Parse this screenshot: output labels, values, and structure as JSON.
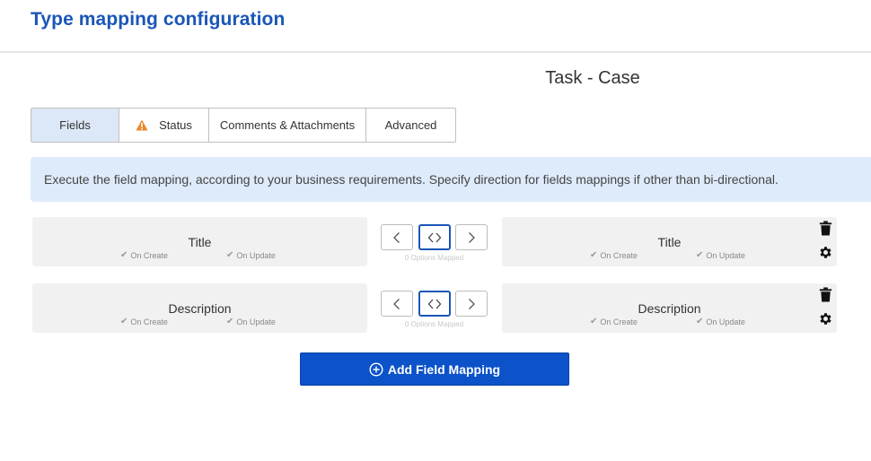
{
  "header": {
    "title": "Type mapping configuration"
  },
  "mapping": {
    "name": "Task - Case"
  },
  "tabs": [
    {
      "label": "Fields",
      "active": true
    },
    {
      "label": "Status",
      "icon": "warning-icon"
    },
    {
      "label": "Comments & Attachments"
    },
    {
      "label": "Advanced"
    }
  ],
  "info": {
    "text": "Execute the field mapping, according to your business requirements. Specify direction for fields mappings if other than bi-directional."
  },
  "rows": [
    {
      "left": {
        "name": "Title",
        "on_create": "On Create",
        "on_update": "On Update"
      },
      "right": {
        "name": "Title",
        "on_create": "On Create",
        "on_update": "On Update"
      },
      "direction": "bi-directional",
      "options_mapped": "0 Options Mapped"
    },
    {
      "left": {
        "name": "Description",
        "on_create": "On Create",
        "on_update": "On Update"
      },
      "right": {
        "name": "Description",
        "on_create": "On Create",
        "on_update": "On Update"
      },
      "direction": "bi-directional",
      "options_mapped": "0 Options Mapped"
    }
  ],
  "actions": {
    "add_label": "Add Field Mapping"
  },
  "colors": {
    "accent": "#1a56b8",
    "button": "#0c52c9",
    "info_bg": "#deebfa",
    "warning": "#e8892b"
  }
}
